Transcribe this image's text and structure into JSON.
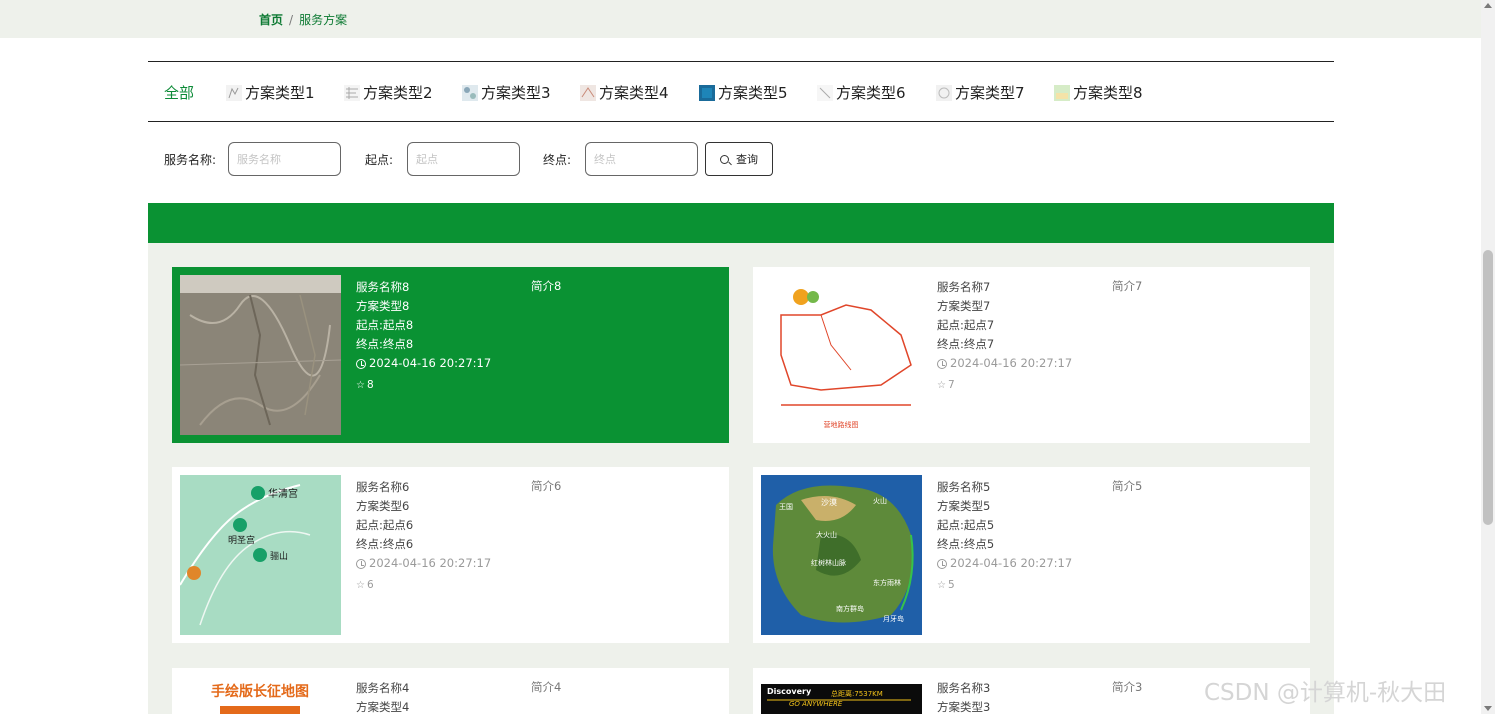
{
  "breadcrumb": {
    "home": "首页",
    "separator": "/",
    "current": "服务方案"
  },
  "tabs": [
    "全部",
    "方案类型1",
    "方案类型2",
    "方案类型3",
    "方案类型4",
    "方案类型5",
    "方案类型6",
    "方案类型7",
    "方案类型8"
  ],
  "active_tab": "全部",
  "search": {
    "name_label": "服务名称:",
    "name_placeholder": "服务名称",
    "start_label": "起点:",
    "start_placeholder": "起点",
    "end_label": "终点:",
    "end_placeholder": "终点",
    "button": "查询"
  },
  "cards": [
    {
      "name": "服务名称8",
      "type": "方案类型8",
      "start": "起点:起点8",
      "end": "终点:终点8",
      "time": "2024-04-16 20:27:17",
      "stars": "8",
      "intro": "简介8",
      "highlighted": true
    },
    {
      "name": "服务名称7",
      "type": "方案类型7",
      "start": "起点:起点7",
      "end": "终点:终点7",
      "time": "2024-04-16 20:27:17",
      "stars": "7",
      "intro": "简介7"
    },
    {
      "name": "服务名称6",
      "type": "方案类型6",
      "start": "起点:起点6",
      "end": "终点:终点6",
      "time": "2024-04-16 20:27:17",
      "stars": "6",
      "intro": "简介6"
    },
    {
      "name": "服务名称5",
      "type": "方案类型5",
      "start": "起点:起点5",
      "end": "终点:终点5",
      "time": "2024-04-16 20:27:17",
      "stars": "5",
      "intro": "简介5"
    },
    {
      "name": "服务名称4",
      "type": "方案类型4",
      "intro": "简介4"
    },
    {
      "name": "服务名称3",
      "type": "方案类型3",
      "intro": "简介3"
    }
  ],
  "images": {
    "card4_title": "手绘版长征地图",
    "card3_title": "Discovery",
    "card3_sub": "GO ANYWHERE",
    "card3_km": "总距离:7537KM",
    "card7_caption": "营地路线图",
    "card6_labels": [
      "华清宫",
      "明圣宫",
      "骊山"
    ],
    "card5_labels": [
      "沙漠",
      "火山",
      "王国",
      "大火山",
      "红树林山脉",
      "东方雨林",
      "南方群岛",
      "月牙岛"
    ]
  },
  "watermark": "CSDN @计算机-秋大田",
  "colors": {
    "brand_green": "#0a9233",
    "bg": "#eef1eb"
  }
}
